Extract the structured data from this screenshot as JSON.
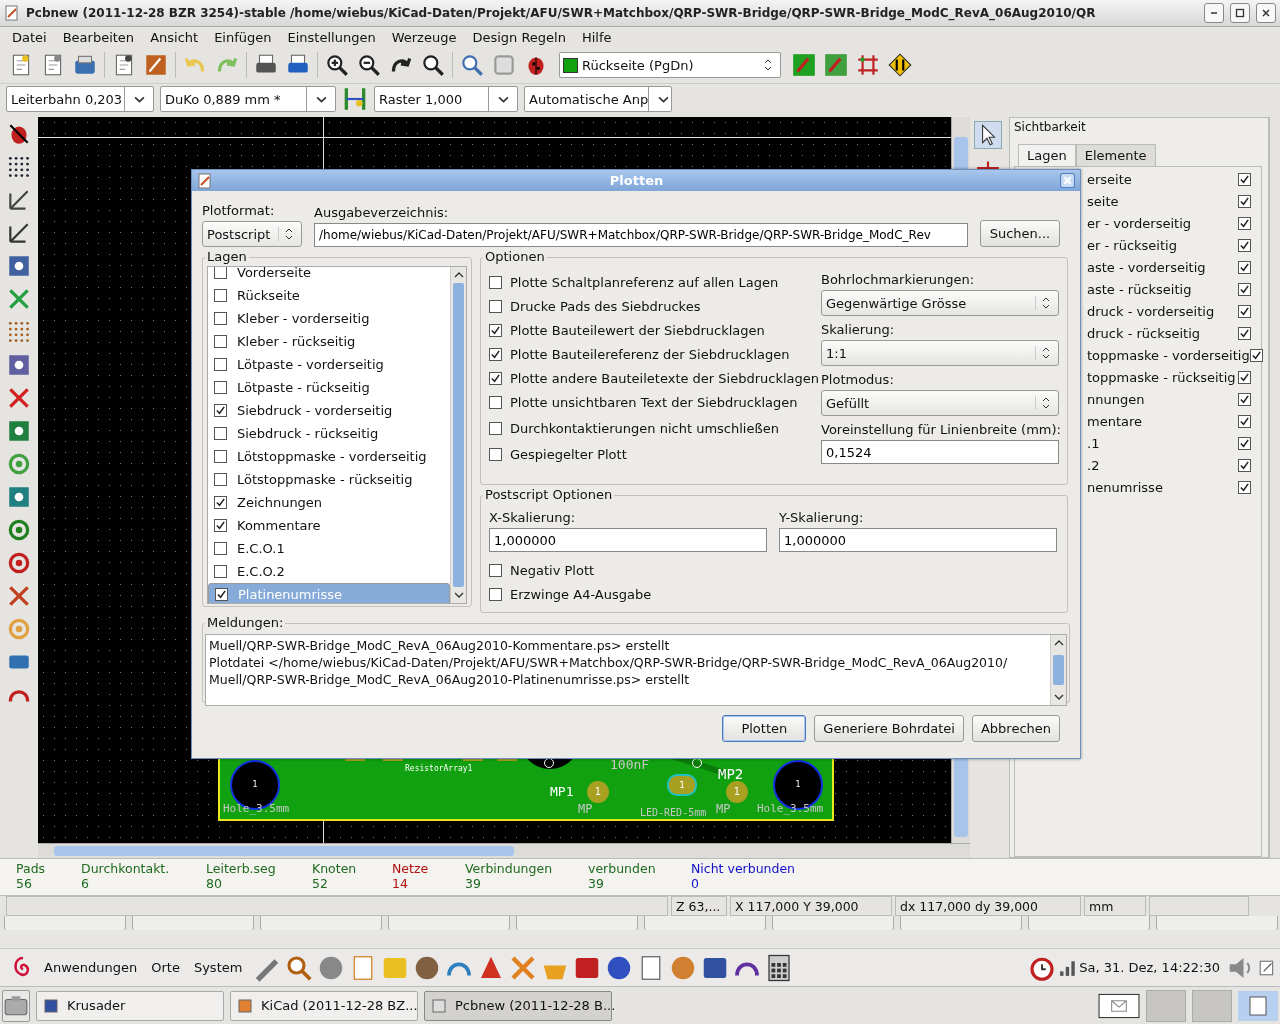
{
  "window": {
    "title": "Pcbnew (2011-12-28 BZR 3254)-stable /home/wiebus/KiCad-Daten/Projekt/AFU/SWR+Matchbox/QRP-SWR-Bridge/QRP-SWR-Bridge_ModC_RevA_06Aug2010/QR"
  },
  "menu": [
    "Datei",
    "Bearbeiten",
    "Ansicht",
    "Einfügen",
    "Einstellungen",
    "Werzeuge",
    "Design Regeln",
    "Hilfe"
  ],
  "toolbar": {
    "layer_select": "Rückseite (PgDn)"
  },
  "toolbar2": {
    "track": "Leiterbahn 0,203",
    "via": "DuKo 0,889 mm *",
    "grid": "Raster 1,000",
    "zoom": "Automatische Anp"
  },
  "canvas": {
    "labels": [
      "Hole_3.5mm",
      "ResistorArray1",
      "100nF",
      "MP1",
      "MP2",
      "MP",
      "LED-RED-5mm",
      "MP",
      "Hole_3.5mm"
    ],
    "pads": [
      "1",
      "1",
      "1",
      "1",
      "1"
    ]
  },
  "visibility": {
    "title": "Sichtbarkeit",
    "tabs": [
      {
        "label": "Lagen",
        "selected": true
      },
      {
        "label": "Elemente",
        "selected": false
      }
    ],
    "layers": [
      {
        "label": "erseite",
        "checked": true
      },
      {
        "label": "seite",
        "checked": true
      },
      {
        "label": "er - vorderseitig",
        "checked": true
      },
      {
        "label": "er - rückseitig",
        "checked": true
      },
      {
        "label": "aste - vorderseitig",
        "checked": true
      },
      {
        "label": "aste - rückseitig",
        "checked": true
      },
      {
        "label": "druck - vorderseitig",
        "checked": true
      },
      {
        "label": "druck - rückseitig",
        "checked": true
      },
      {
        "label": "toppmaske - vorderseitig",
        "checked": true
      },
      {
        "label": "toppmaske - rückseitig",
        "checked": true
      },
      {
        "label": "nnungen",
        "checked": true
      },
      {
        "label": "mentare",
        "checked": true
      },
      {
        "label": ".1",
        "checked": true
      },
      {
        "label": ".2",
        "checked": true
      },
      {
        "label": "nenumrisse",
        "checked": true
      }
    ]
  },
  "dialog": {
    "title": "Plotten",
    "plot_format": {
      "label": "Plotformat:",
      "value": "Postscript"
    },
    "output_dir": {
      "label": "Ausgabeverzeichnis:",
      "value": "/home/wiebus/KiCad-Daten/Projekt/AFU/SWR+Matchbox/QRP-SWR-Bridge/QRP-SWR-Bridge_ModC_Rev"
    },
    "browse_button": "Suchen...",
    "layers": {
      "title": "Lagen",
      "items": [
        {
          "label": "Vorderseite",
          "checked": false,
          "selected": false
        },
        {
          "label": "Rückseite",
          "checked": false,
          "selected": false
        },
        {
          "label": "Kleber - vorderseitig",
          "checked": false,
          "selected": false
        },
        {
          "label": "Kleber - rückseitig",
          "checked": false,
          "selected": false
        },
        {
          "label": "Lötpaste - vorderseitig",
          "checked": false,
          "selected": false
        },
        {
          "label": "Lötpaste - rückseitig",
          "checked": false,
          "selected": false
        },
        {
          "label": "Siebdruck - vorderseitig",
          "checked": true,
          "selected": false
        },
        {
          "label": "Siebdruck - rückseitig",
          "checked": false,
          "selected": false
        },
        {
          "label": "Lötstoppmaske - vorderseitig",
          "checked": false,
          "selected": false
        },
        {
          "label": "Lötstoppmaske - rückseitig",
          "checked": false,
          "selected": false
        },
        {
          "label": "Zeichnungen",
          "checked": true,
          "selected": false
        },
        {
          "label": "Kommentare",
          "checked": true,
          "selected": false
        },
        {
          "label": "E.C.O.1",
          "checked": false,
          "selected": false
        },
        {
          "label": "E.C.O.2",
          "checked": false,
          "selected": false
        },
        {
          "label": "Platinenumrisse",
          "checked": true,
          "selected": true
        }
      ]
    },
    "options": {
      "title": "Optionen",
      "checks": [
        {
          "label": "Plotte Schaltplanreferenz auf allen Lagen",
          "checked": false
        },
        {
          "label": "Drucke Pads des Siebdruckes",
          "checked": false
        },
        {
          "label": "Plotte Bauteilewert der Siebdrucklagen",
          "checked": true
        },
        {
          "label": "Plotte Bauteilereferenz der Siebdrucklagen",
          "checked": true
        },
        {
          "label": "Plotte andere Bauteiletexte der Siebdrucklagen",
          "checked": true
        },
        {
          "label": "Plotte unsichtbaren Text der Siebdrucklagen",
          "checked": false
        },
        {
          "label": "Durchkontaktierungen nicht umschließen",
          "checked": false
        },
        {
          "label": "Gespiegelter Plott",
          "checked": false
        }
      ],
      "selects": [
        {
          "label": "Bohrlochmarkierungen:",
          "value": "Gegenwärtige Grösse"
        },
        {
          "label": "Skalierung:",
          "value": "1:1"
        },
        {
          "label": "Plotmodus:",
          "value": "Gefüllt"
        }
      ],
      "line_width": {
        "label": "Voreinstellung für Linienbreite (mm):",
        "value": "0,1524"
      }
    },
    "postscript": {
      "title": "Postscript Optionen",
      "fields": [
        {
          "label": "X-Skalierung:",
          "value": "1,000000"
        },
        {
          "label": "Y-Skalierung:",
          "value": "1,000000"
        }
      ],
      "checks": [
        {
          "label": "Negativ Plott",
          "checked": false
        },
        {
          "label": "Erzwinge A4-Ausgabe",
          "checked": false
        }
      ]
    },
    "messages": {
      "label": "Meldungen:",
      "lines": [
        "Muell/QRP-SWR-Bridge_ModC_RevA_06Aug2010-Kommentare.ps> erstellt",
        "Plotdatei </home/wiebus/KiCad-Daten/Projekt/AFU/SWR+Matchbox/QRP-SWR-Bridge/QRP-SWR-Bridge_ModC_RevA_06Aug2010/",
        "Muell/QRP-SWR-Bridge_ModC_RevA_06Aug2010-Platinenumrisse.ps> erstellt"
      ]
    },
    "buttons": [
      {
        "label": "Plotten",
        "default": true
      },
      {
        "label": "Generiere Bohrdatei",
        "default": false
      },
      {
        "label": "Abbrechen",
        "default": false
      }
    ]
  },
  "counters": [
    {
      "label": "Pads",
      "value": "56",
      "color": "#1e6a1e"
    },
    {
      "label": "Durchkontakt.",
      "value": "6",
      "color": "#1e6a1e"
    },
    {
      "label": "Leiterb.seg",
      "value": "80",
      "color": "#1e6a1e"
    },
    {
      "label": "Knoten",
      "value": "52",
      "color": "#1e6a1e"
    },
    {
      "label": "Netze",
      "value": "14",
      "color": "#b01010"
    },
    {
      "label": "Verbindungen",
      "value": "39",
      "color": "#1e6a1e"
    },
    {
      "label": "verbunden",
      "value": "39",
      "color": "#1e6a1e"
    },
    {
      "label": "Nicht verbunden",
      "value": "0",
      "color": "#1010c8"
    }
  ],
  "status_bar": [
    "Z 63,...",
    "X 117,000  Y 39,000",
    "dx 117,000  dy 39,000",
    "mm"
  ],
  "panel": {
    "menus": [
      "Anwendungen",
      "Orte",
      "System"
    ],
    "clock": "Sa, 31. Dez, 14:22:30"
  },
  "taskbar": [
    {
      "label": "Krusader",
      "selected": false
    },
    {
      "label": "KiCad (2011-12-28 BZ...",
      "selected": false
    },
    {
      "label": "Pcbnew (2011-12-28 B...",
      "selected": true
    }
  ]
}
